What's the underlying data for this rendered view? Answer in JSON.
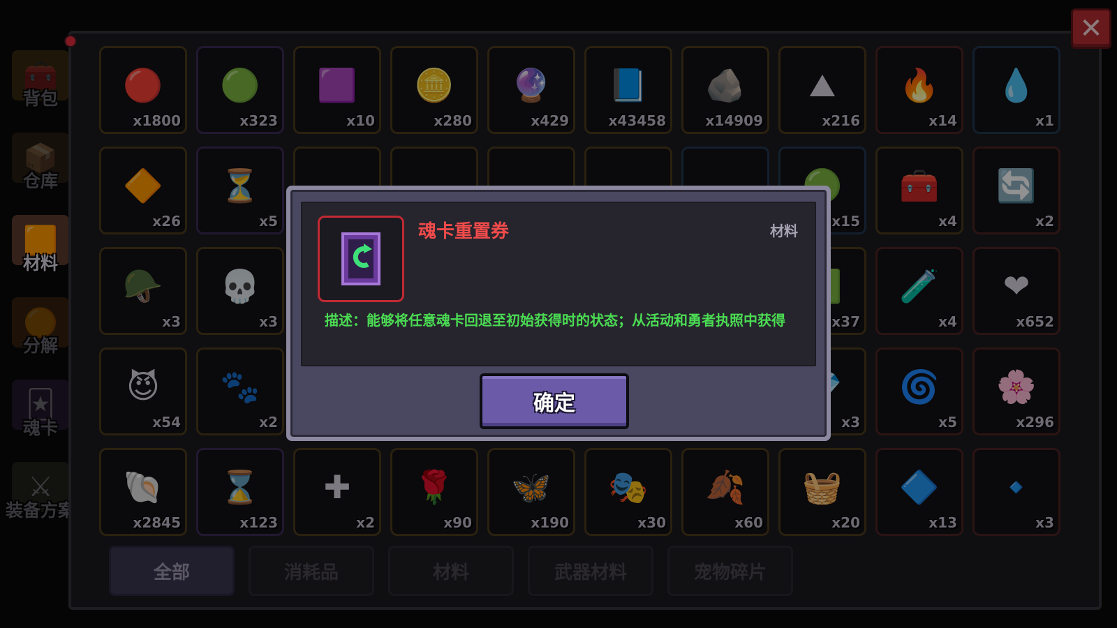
{
  "sidebar": {
    "items": [
      {
        "label": "背包",
        "icon": "chest-icon",
        "active": false
      },
      {
        "label": "仓库",
        "icon": "warehouse-icon",
        "active": false
      },
      {
        "label": "材料",
        "icon": "material-icon",
        "active": true
      },
      {
        "label": "分解",
        "icon": "decompose-icon",
        "active": false
      },
      {
        "label": "魂卡",
        "icon": "soul-card-icon",
        "active": false
      },
      {
        "label": "装备方案",
        "icon": "equipment-plan-icon",
        "active": false
      }
    ],
    "notification_dot": true
  },
  "close_button": {
    "label": "✕"
  },
  "grid": {
    "rows": [
      [
        {
          "icon": "gem-icon",
          "glyph": "🔴",
          "count": "x1800",
          "rarity": "gold"
        },
        {
          "icon": "green-coin-icon",
          "glyph": "🟢",
          "count": "x323",
          "rarity": "purple"
        },
        {
          "icon": "purple-crystal-icon",
          "glyph": "🟪",
          "count": "x10",
          "rarity": "gold"
        },
        {
          "icon": "gold-coin-icon",
          "glyph": "🪙",
          "count": "x280",
          "rarity": "gold"
        },
        {
          "icon": "purple-flame-icon",
          "glyph": "🔮",
          "count": "x429",
          "rarity": "gold"
        },
        {
          "icon": "exp-book-icon",
          "glyph": "📘",
          "count": "x43458",
          "rarity": "gold"
        },
        {
          "icon": "stone-pile-icon",
          "glyph": "🪨",
          "count": "x14909",
          "rarity": "gold"
        },
        {
          "icon": "ore-pile-icon",
          "glyph": "⛰",
          "count": "x216",
          "rarity": "gold"
        },
        {
          "icon": "red-ore-icon",
          "glyph": "🔥",
          "count": "x14",
          "rarity": "red"
        },
        {
          "icon": "blue-key-drop-icon",
          "glyph": "💧",
          "count": "x1",
          "rarity": "blue"
        }
      ],
      [
        {
          "icon": "orange-key-drop-icon",
          "glyph": "🔶",
          "count": "x26",
          "rarity": "gold"
        },
        {
          "icon": "hourglass-coin-icon",
          "glyph": "⏳",
          "count": "x5",
          "rarity": "purple"
        },
        {
          "icon": "hidden-item-icon",
          "glyph": "",
          "count": "",
          "rarity": "gold"
        },
        {
          "icon": "hidden-item-icon",
          "glyph": "",
          "count": "",
          "rarity": "gold"
        },
        {
          "icon": "hidden-item-icon",
          "glyph": "",
          "count": "",
          "rarity": "gold"
        },
        {
          "icon": "hidden-item-icon",
          "glyph": "",
          "count": "",
          "rarity": "gold"
        },
        {
          "icon": "hidden-item-icon",
          "glyph": "",
          "count": "",
          "rarity": "blue"
        },
        {
          "icon": "green-orb-icon",
          "glyph": "🟢",
          "count": "x15",
          "rarity": "blue"
        },
        {
          "icon": "chest-coin-icon",
          "glyph": "🧰",
          "count": "x4",
          "rarity": "gold"
        },
        {
          "icon": "soul-card-reset-icon",
          "glyph": "🔄",
          "count": "x2",
          "rarity": "red"
        }
      ],
      [
        {
          "icon": "viking-helmet-icon",
          "glyph": "🪖",
          "count": "x3",
          "rarity": "gold"
        },
        {
          "icon": "skull-figure-icon",
          "glyph": "💀",
          "count": "x3",
          "rarity": "gold"
        },
        {
          "icon": "hidden-item-icon",
          "glyph": "",
          "count": "",
          "rarity": "gold"
        },
        {
          "icon": "hidden-item-icon",
          "glyph": "",
          "count": "",
          "rarity": "gold"
        },
        {
          "icon": "hidden-item-icon",
          "glyph": "",
          "count": "",
          "rarity": "gold"
        },
        {
          "icon": "hidden-item-icon",
          "glyph": "",
          "count": "",
          "rarity": "gold"
        },
        {
          "icon": "hidden-item-icon",
          "glyph": "",
          "count": "",
          "rarity": "gold"
        },
        {
          "icon": "slime-item-icon",
          "glyph": "🟩",
          "count": "x37",
          "rarity": "gold"
        },
        {
          "icon": "potion-set-icon",
          "glyph": "🧪",
          "count": "x4",
          "rarity": "red"
        },
        {
          "icon": "heart-icon",
          "glyph": "❤",
          "count": "x652",
          "rarity": "red"
        }
      ],
      [
        {
          "icon": "purple-face-coin-icon",
          "glyph": "😈",
          "count": "x54",
          "rarity": "gold"
        },
        {
          "icon": "pink-paw-coin-icon",
          "glyph": "🐾",
          "count": "x2",
          "rarity": "gold"
        },
        {
          "icon": "hidden-item-icon",
          "glyph": "",
          "count": "",
          "rarity": "gold"
        },
        {
          "icon": "hidden-item-icon",
          "glyph": "",
          "count": "",
          "rarity": "gold"
        },
        {
          "icon": "hidden-item-icon",
          "glyph": "",
          "count": "",
          "rarity": "gold"
        },
        {
          "icon": "hidden-item-icon",
          "glyph": "",
          "count": "",
          "rarity": "gold"
        },
        {
          "icon": "hidden-item-icon",
          "glyph": "",
          "count": "",
          "rarity": "gold"
        },
        {
          "icon": "pink-crystal-icon",
          "glyph": "💎",
          "count": "x3",
          "rarity": "gold"
        },
        {
          "icon": "portal-icon",
          "glyph": "🌀",
          "count": "x5",
          "rarity": "red"
        },
        {
          "icon": "pink-flower-icon",
          "glyph": "🌸",
          "count": "x296",
          "rarity": "red"
        }
      ],
      [
        {
          "icon": "purple-shell-icon",
          "glyph": "🐚",
          "count": "x2845",
          "rarity": "gold"
        },
        {
          "icon": "red-hourglass-coin-icon",
          "glyph": "⌛",
          "count": "x123",
          "rarity": "purple"
        },
        {
          "icon": "gold-cross-icon",
          "glyph": "✚",
          "count": "x2",
          "rarity": "gold"
        },
        {
          "icon": "rose-icon",
          "glyph": "🌹",
          "count": "x90",
          "rarity": "gold"
        },
        {
          "icon": "butterfly-icon",
          "glyph": "🦋",
          "count": "x190",
          "rarity": "gold"
        },
        {
          "icon": "mask-icon",
          "glyph": "🎭",
          "count": "x30",
          "rarity": "gold"
        },
        {
          "icon": "ginkgo-leaf-icon",
          "glyph": "🍂",
          "count": "x60",
          "rarity": "gold"
        },
        {
          "icon": "nest-icon",
          "glyph": "🧺",
          "count": "x20",
          "rarity": "gold"
        },
        {
          "icon": "rainbow-gem-icon",
          "glyph": "🔷",
          "count": "x13",
          "rarity": "red"
        },
        {
          "icon": "blue-gem-icon",
          "glyph": "🔹",
          "count": "x3",
          "rarity": "red"
        }
      ]
    ]
  },
  "tabs": [
    {
      "label": "全部",
      "active": true
    },
    {
      "label": "消耗品",
      "active": false
    },
    {
      "label": "材料",
      "active": false
    },
    {
      "label": "武器材料",
      "active": false
    },
    {
      "label": "宠物碎片",
      "active": false
    }
  ],
  "dialog": {
    "item_name": "魂卡重置券",
    "item_type": "材料",
    "item_icon": "soul-card-reset-icon",
    "description": "描述：能够将任意魂卡回退至初始获得时的状态；从活动和勇者执照中获得",
    "confirm_label": "确定",
    "name_color": "#f04b4b",
    "description_color": "#4bdc53"
  }
}
